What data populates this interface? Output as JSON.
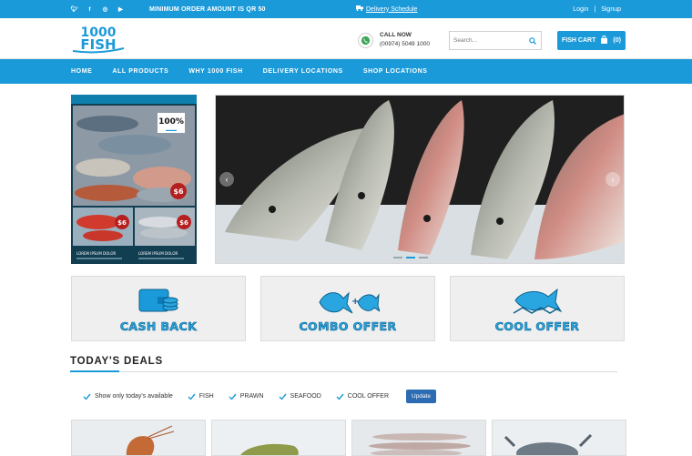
{
  "topbar": {
    "social_icons": [
      "twitter-icon",
      "facebook-icon",
      "instagram-icon",
      "youtube-icon"
    ],
    "min_order": "MINIMUM ORDER AMOUNT IS QR 50",
    "delivery_link": "Delivery Schedule",
    "login": "Login",
    "separator": "|",
    "signup": "Signup"
  },
  "header": {
    "logo_line1": "1000",
    "logo_line2": "FISH",
    "call_label": "CALL NOW",
    "call_number": "(00974) 5049 1000",
    "search_placeholder": "Search...",
    "cart_label": "FISH CART",
    "cart_count": "(0)"
  },
  "nav": {
    "items": [
      "HOME",
      "ALL PRODUCTS",
      "WHY 1000 FISH",
      "DELIVERY LOCATIONS",
      "SHOP LOCATIONS"
    ]
  },
  "promo": {
    "badge_value": "100%",
    "price_tags": [
      "$6",
      "$6",
      "$6"
    ],
    "captions": [
      "LOREM IPSUM DOLOR",
      "LOREM IPSUM DOLOR"
    ]
  },
  "slider": {
    "prev_icon": "chevron-left-icon",
    "next_icon": "chevron-right-icon",
    "slides": 3,
    "active_slide": 2
  },
  "offers": [
    {
      "title": "CASH BACK",
      "icon": "wallet-coin-icon"
    },
    {
      "title": "COMBO OFFER",
      "icon": "fish-plus-fish-icon"
    },
    {
      "title": "COOL OFFER",
      "icon": "fish-on-ice-icon"
    }
  ],
  "deals": {
    "title": "TODAY'S  DEALS",
    "filters": [
      "Show only today's available",
      "FISH",
      "PRAWN",
      "SEAFOOD",
      "COOL OFFER"
    ],
    "update_label": "Update"
  },
  "colors": {
    "brand_blue": "#1b9ad9",
    "offer_text": "#29a6e0",
    "update_button": "#2b6cb3"
  }
}
